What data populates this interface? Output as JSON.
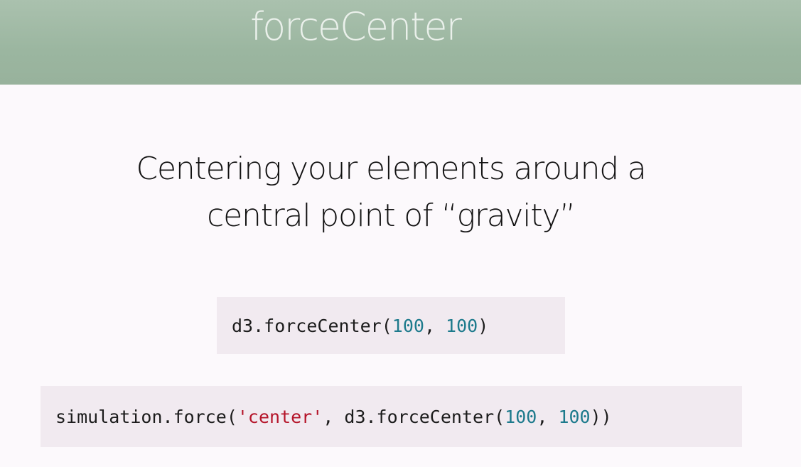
{
  "header": {
    "title": "forceCenter"
  },
  "subtitle": {
    "line1": "Centering your elements around a",
    "line2": "central point of “gravity”"
  },
  "code_small": {
    "prefix": "d3.forceCenter(",
    "arg1": "100",
    "sep": ", ",
    "arg2": "100",
    "suffix": ")"
  },
  "code_large": {
    "prefix": "simulation.force(",
    "string_arg": "'center'",
    "middle": ", d3.forceCenter(",
    "arg1": "100",
    "sep": ", ",
    "arg2": "100",
    "suffix": "))"
  },
  "colors": {
    "header_bg": "#9bb6a0",
    "code_bg": "#f1eaf0",
    "number": "#1d7a8c",
    "string": "#b5152a"
  }
}
